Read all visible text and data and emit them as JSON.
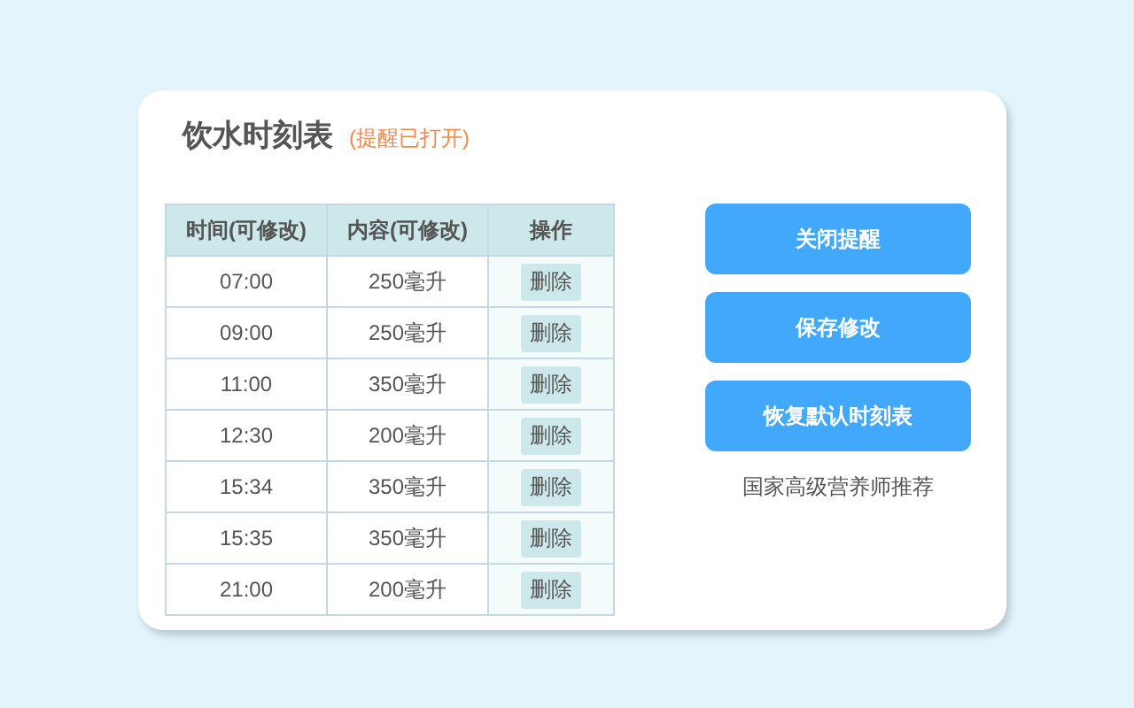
{
  "title": "饮水时刻表",
  "status": "(提醒已打开)",
  "table": {
    "columns": [
      "时间(可修改)",
      "内容(可修改)",
      "操作"
    ],
    "rows": [
      {
        "time": "07:00",
        "amount": "250毫升",
        "action": "删除"
      },
      {
        "time": "09:00",
        "amount": "250毫升",
        "action": "删除"
      },
      {
        "time": "11:00",
        "amount": "350毫升",
        "action": "删除"
      },
      {
        "time": "12:30",
        "amount": "200毫升",
        "action": "删除"
      },
      {
        "time": "15:34",
        "amount": "350毫升",
        "action": "删除"
      },
      {
        "time": "15:35",
        "amount": "350毫升",
        "action": "删除"
      },
      {
        "time": "21:00",
        "amount": "200毫升",
        "action": "删除"
      }
    ]
  },
  "buttons": [
    "关闭提醒",
    "保存修改",
    "恢复默认时刻表"
  ],
  "note": "国家高级营养师推荐"
}
